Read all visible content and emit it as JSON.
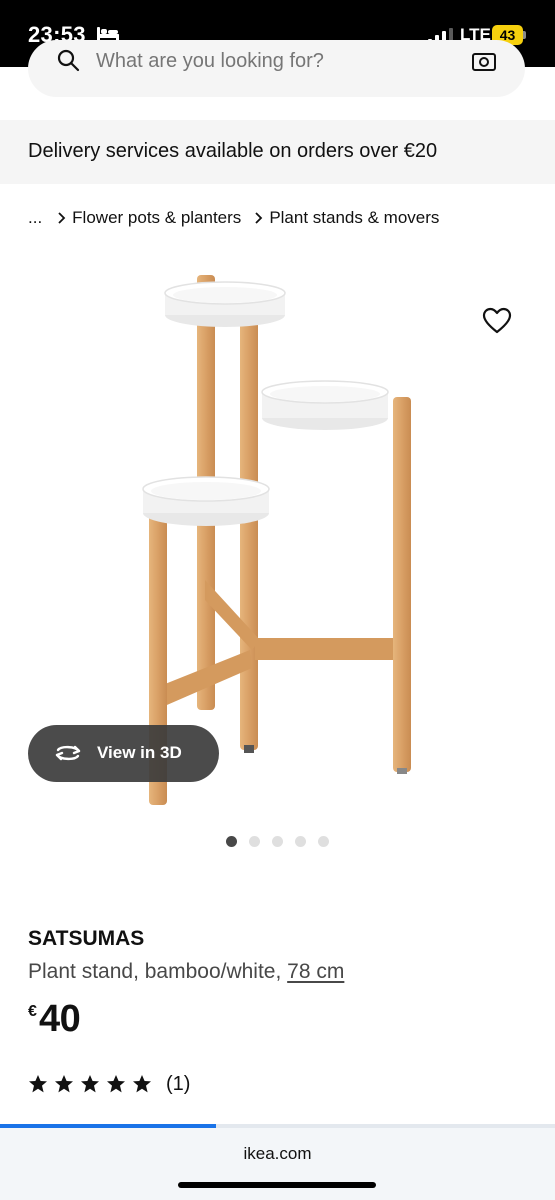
{
  "status_bar": {
    "time": "23:53",
    "network": "LTE",
    "battery": "43"
  },
  "search": {
    "placeholder": "What are you looking for?"
  },
  "banner": {
    "text": "Delivery services available on orders over €20"
  },
  "breadcrumb": {
    "ellipsis": "...",
    "items": [
      "Flower pots & planters",
      "Plant stands & movers"
    ]
  },
  "gallery": {
    "view_3d_label": "View in 3D",
    "image_count": 5,
    "active_index": 0
  },
  "product": {
    "name": "SATSUMAS",
    "description": "Plant stand, bamboo/white,",
    "size": "78 cm",
    "currency": "€",
    "price": "40",
    "rating": 5,
    "review_count": "(1)"
  },
  "browser": {
    "url": "ikea.com",
    "load_progress": 0.39
  },
  "colors": {
    "accent_blue": "#1a73e8",
    "battery_yellow": "#f6d00e",
    "bamboo": "#d9a066"
  }
}
